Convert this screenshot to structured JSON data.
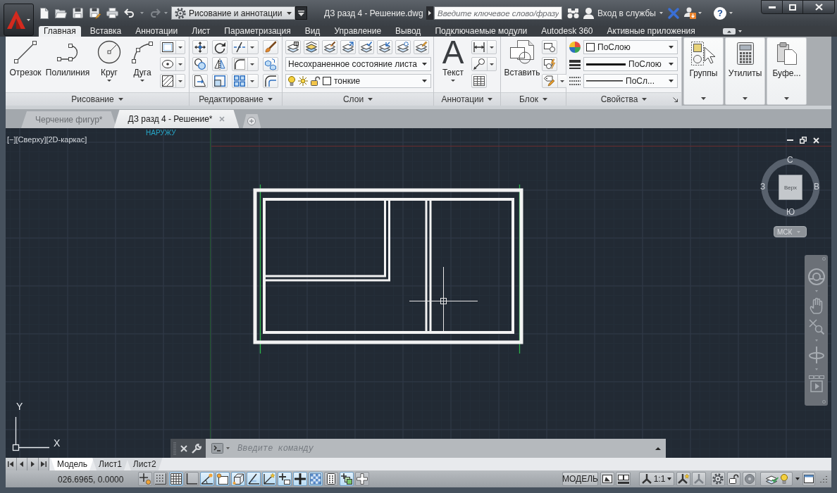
{
  "quick_access": {
    "undo": {
      "disabled": false
    },
    "redo": {
      "disabled": true
    },
    "workspace": "Рисование и аннотации"
  },
  "window": {
    "title": "ДЗ разд 4 - Решение.dwg"
  },
  "search": {
    "placeholder": "Введите ключевое слово/фразу"
  },
  "account": {
    "label": "Вход в службы"
  },
  "help": {
    "glyph": "?"
  },
  "ribbon_tabs": [
    {
      "label": "Главная",
      "selected": true
    },
    {
      "label": "Вставка",
      "selected": false
    },
    {
      "label": "Аннотации",
      "selected": false
    },
    {
      "label": "Лист",
      "selected": false
    },
    {
      "label": "Параметризация",
      "selected": false
    },
    {
      "label": "Вид",
      "selected": false
    },
    {
      "label": "Управление",
      "selected": false
    },
    {
      "label": "Вывод",
      "selected": false
    },
    {
      "label": "Подключаемые модули",
      "selected": false
    },
    {
      "label": "Autodesk 360",
      "selected": false
    },
    {
      "label": "Активные приложения",
      "selected": false
    }
  ],
  "ribbon": {
    "draw": {
      "title": "Рисование",
      "tools": [
        {
          "label": "Отрезок"
        },
        {
          "label": "Полилиния"
        },
        {
          "label": "Круг"
        },
        {
          "label": "Дуга"
        }
      ]
    },
    "modify": {
      "title": "Редактирование"
    },
    "layers": {
      "title": "Слои",
      "layer_state": "Несохраненное состояние листа",
      "current_layer": "тонкие"
    },
    "annotation": {
      "title": "Аннотации",
      "text_tool": {
        "glyph": "A",
        "label": "Текст"
      }
    },
    "block": {
      "title": "Блок",
      "insert_label": "Вставить"
    },
    "properties": {
      "title": "Свойства",
      "color_setting": "ПоСлою",
      "lineweight": "ПоСлою",
      "linetype": "ПоСл..."
    },
    "collapsed_panels": [
      {
        "label": "Группы"
      },
      {
        "label": "Утилиты"
      },
      {
        "label": "Буфе..."
      }
    ]
  },
  "document_tabs": [
    {
      "label": "Черчение фигур*",
      "selected": false
    },
    {
      "label": "ДЗ разд 4 - Решение*",
      "selected": true
    }
  ],
  "viewport": {
    "controls": [
      "[−]",
      "[Сверху]",
      "[2D-каркас]"
    ],
    "drawing_text": "НАРУЖУ"
  },
  "viewcube": {
    "face": "Верх",
    "north": "С",
    "west": "З",
    "east": "В",
    "south": "Ю",
    "ucs": "МСК"
  },
  "ucs_icon": {
    "x_label": "X",
    "y_label": "Y"
  },
  "command_line": {
    "placeholder": "Введите команду"
  },
  "layout_tabs": [
    {
      "label": "Модель",
      "selected": true
    },
    {
      "label": "Лист1",
      "selected": false
    },
    {
      "label": "Лист2",
      "selected": false
    }
  ],
  "status_bar": {
    "coordinates": "026.6965, 0.0000",
    "toggles": [
      {
        "on": false
      },
      {
        "on": false
      },
      {
        "on": true
      },
      {
        "on": false
      },
      {
        "on": true
      },
      {
        "on": true
      },
      {
        "on": true
      },
      {
        "on": true
      },
      {
        "on": true
      },
      {
        "on": true
      },
      {
        "on": true
      },
      {
        "on": true
      },
      {
        "on": false
      },
      {
        "on": true
      },
      {
        "on": false
      }
    ],
    "space": "МОДЕЛЬ",
    "annotation_scale": "1:1"
  }
}
